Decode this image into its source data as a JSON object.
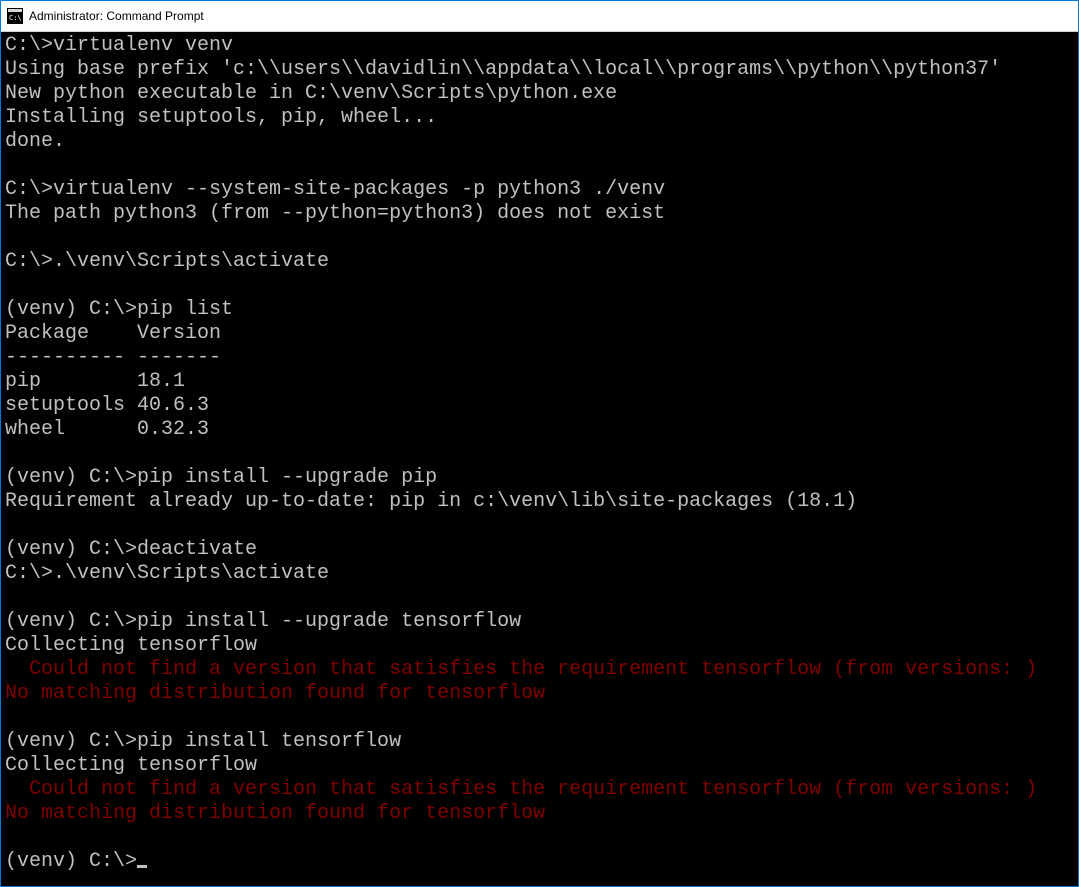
{
  "window": {
    "title": "Administrator: Command Prompt"
  },
  "terminal": {
    "lines": [
      {
        "cls": "t-out",
        "text": "C:\\>virtualenv venv"
      },
      {
        "cls": "t-out",
        "text": "Using base prefix 'c:\\\\users\\\\davidlin\\\\appdata\\\\local\\\\programs\\\\python\\\\python37'"
      },
      {
        "cls": "t-out",
        "text": "New python executable in C:\\venv\\Scripts\\python.exe"
      },
      {
        "cls": "t-out",
        "text": "Installing setuptools, pip, wheel..."
      },
      {
        "cls": "t-out",
        "text": "done."
      },
      {
        "cls": "t-out",
        "text": ""
      },
      {
        "cls": "t-out",
        "text": "C:\\>virtualenv --system-site-packages -p python3 ./venv"
      },
      {
        "cls": "t-out",
        "text": "The path python3 (from --python=python3) does not exist"
      },
      {
        "cls": "t-out",
        "text": ""
      },
      {
        "cls": "t-out",
        "text": "C:\\>.\\venv\\Scripts\\activate"
      },
      {
        "cls": "t-out",
        "text": ""
      },
      {
        "cls": "t-out",
        "text": "(venv) C:\\>pip list"
      },
      {
        "cls": "t-out",
        "text": "Package    Version"
      },
      {
        "cls": "t-out",
        "text": "---------- -------"
      },
      {
        "cls": "t-out",
        "text": "pip        18.1"
      },
      {
        "cls": "t-out",
        "text": "setuptools 40.6.3"
      },
      {
        "cls": "t-out",
        "text": "wheel      0.32.3"
      },
      {
        "cls": "t-out",
        "text": ""
      },
      {
        "cls": "t-out",
        "text": "(venv) C:\\>pip install --upgrade pip"
      },
      {
        "cls": "t-out",
        "text": "Requirement already up-to-date: pip in c:\\venv\\lib\\site-packages (18.1)"
      },
      {
        "cls": "t-out",
        "text": ""
      },
      {
        "cls": "t-out",
        "text": "(venv) C:\\>deactivate"
      },
      {
        "cls": "t-out",
        "text": "C:\\>.\\venv\\Scripts\\activate"
      },
      {
        "cls": "t-out",
        "text": ""
      },
      {
        "cls": "t-out",
        "text": "(venv) C:\\>pip install --upgrade tensorflow"
      },
      {
        "cls": "t-out",
        "text": "Collecting tensorflow"
      },
      {
        "cls": "t-err",
        "text": "  Could not find a version that satisfies the requirement tensorflow (from versions: )"
      },
      {
        "cls": "t-err",
        "text": "No matching distribution found for tensorflow"
      },
      {
        "cls": "t-out",
        "text": ""
      },
      {
        "cls": "t-out",
        "text": "(venv) C:\\>pip install tensorflow"
      },
      {
        "cls": "t-out",
        "text": "Collecting tensorflow"
      },
      {
        "cls": "t-err",
        "text": "  Could not find a version that satisfies the requirement tensorflow (from versions: )"
      },
      {
        "cls": "t-err",
        "text": "No matching distribution found for tensorflow"
      },
      {
        "cls": "t-out",
        "text": ""
      }
    ],
    "prompt": "(venv) C:\\>"
  }
}
